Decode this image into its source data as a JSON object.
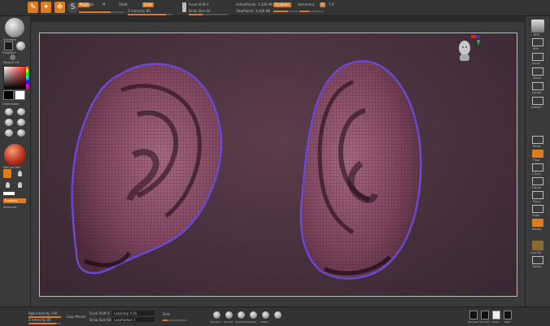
{
  "topbar": {
    "buttons": [
      {
        "icon": "edit-icon",
        "label": "Edit"
      },
      {
        "icon": "draw-icon",
        "label": "Draw"
      },
      {
        "icon": "zspheres-icon",
        "label": "S"
      }
    ],
    "draw_modes": [
      "Mrgb",
      "Rgb",
      "M",
      "Zadd",
      "Zsub"
    ],
    "active_draw_mode": "Zadd",
    "intensity_label": "Z Intensity 85",
    "focal_label": "Focal Shift 0",
    "draw_size_label": "Draw Size 64",
    "active_points": "ActivePoints: 3.426 Mil",
    "total_points": "TotalPoints: 3.426 Mil",
    "dynamic_label": "Dynamic",
    "symmetry_label": "Symmetry",
    "accent_color": "#e07a1f"
  },
  "leftbar": {
    "brush_label": "Standard",
    "stroke_label": "DragRect",
    "alpha_label": "Alpha Off",
    "texture_label": "Texture Off",
    "material_label": "MatCap Red",
    "gradient_label": "Gradient",
    "switch_color_label": "SwitchColor",
    "alternate_label": "Alternate"
  },
  "bottombar": {
    "rgb_intensity": "Rgb Intensity 100",
    "z_intensity_label": "Z Intensity 85",
    "focal_label": "Focal Shift 0",
    "draw_size_label": "Draw Size 64",
    "lazy_label": "Lazy Mouse",
    "lazy_step": "LazyStep 0.05",
    "lazy_radius": "LazyRadius 1",
    "dots_label": "Dots",
    "spheres": [
      "Standard",
      "Smooth",
      "ClayBuildup",
      "Move",
      "Inflate",
      "CurveTube"
    ],
    "brush_names": [
      "Standard",
      "Smooth",
      "Inflate",
      "Mask"
    ],
    "perspective_label": "Persp",
    "floor_label": "Floor"
  },
  "rightbar": {
    "items": [
      "BPR",
      "SPix",
      "Scroll",
      "Zoom",
      "Actual",
      "AAHalf",
      "Persp",
      "Floor",
      "L.Sym",
      "Frame",
      "Move",
      "Scale",
      "Rotate",
      "Line Fill",
      "Transp",
      "Ghost",
      "Solo",
      "Xpose"
    ]
  }
}
